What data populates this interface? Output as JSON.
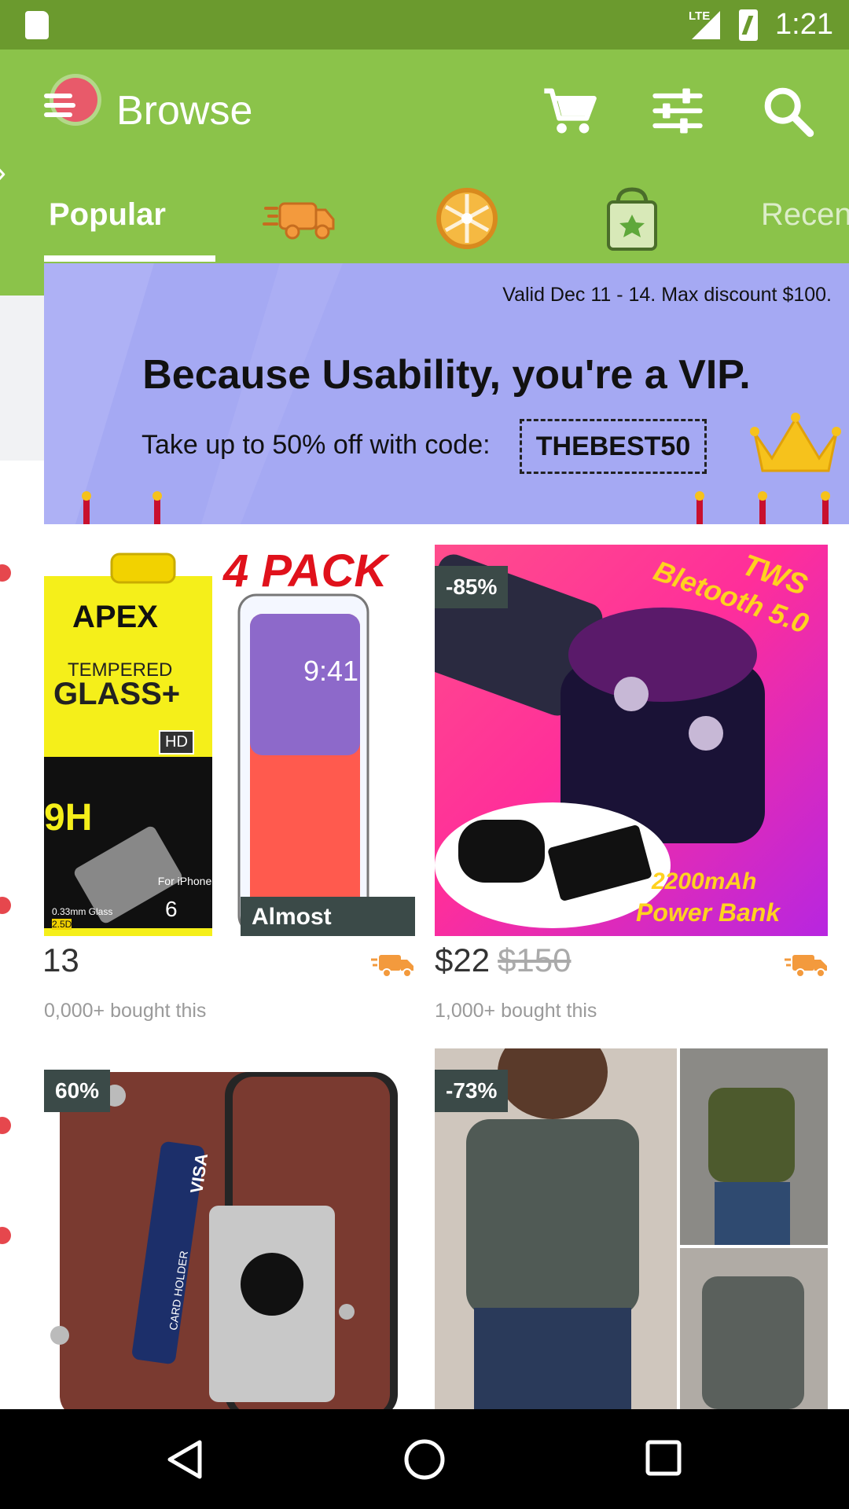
{
  "status_bar": {
    "network": "LTE",
    "time": "1:21"
  },
  "app_bar": {
    "title": "Browse",
    "icons": [
      "menu-icon",
      "cart-icon",
      "filter-icon",
      "search-icon"
    ]
  },
  "tabs": {
    "active": "Popular",
    "icons": [
      "express-delivery-icon",
      "wheel-icon",
      "shopping-bag-icon"
    ],
    "partial": "Recen"
  },
  "banner": {
    "valid": "Valid Dec 11 - 14. Max discount $100.",
    "headline": "Because Usability, you're a VIP.",
    "offer": "Take up to 50% off with code:",
    "code": "THEBEST50"
  },
  "products": [
    {
      "price": "13",
      "bought": "0,000+ bought this",
      "image_text": {
        "pack": "4 PACK",
        "brand": "APEX",
        "line1": "TEMPERED",
        "line2": "GLASS+",
        "hd": "HD",
        "hardness": "9H",
        "phone_time": "9:41",
        "for": "For iPhone",
        "model": "6",
        "thickness": "0.33mm Glass",
        "edges": "2.5D"
      },
      "overlay": "Almost Gone!"
    },
    {
      "badge": "-85%",
      "price": "$22",
      "old_price": "$150",
      "bought": "1,000+ bought this",
      "image_text": {
        "tws": "TWS",
        "bt": "Bletooth 5.0",
        "capacity": "2200mAh",
        "bank": "Power Bank"
      }
    },
    {
      "badge": "60%",
      "image_text": {
        "visa": "VISA",
        "holder": "CARD HOLDER"
      }
    },
    {
      "badge": "-73%"
    }
  ],
  "colors": {
    "status_bar": "#6b9a2e",
    "app_bar": "#8bc34a",
    "banner": "#a5a9f3",
    "badge": "#3b4a48",
    "truck": "#f39a3d"
  }
}
